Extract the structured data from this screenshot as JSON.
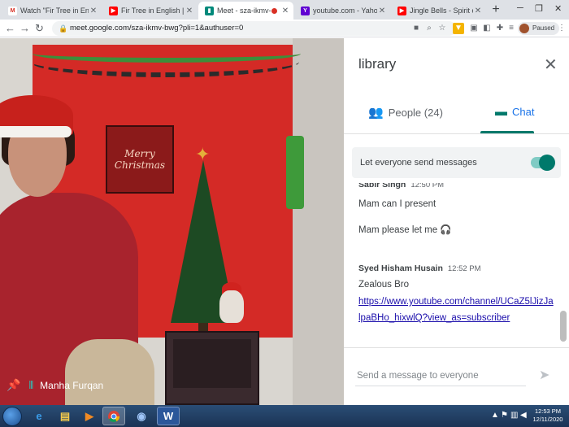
{
  "tabs": [
    {
      "label": "Watch \"Fir Tree in English | Stori",
      "favicon": "gmail-icon",
      "color": "#d93025"
    },
    {
      "label": "Fir Tree in English | Stories for T",
      "favicon": "youtube-icon",
      "color": "#ff0000"
    },
    {
      "label": "Meet - sza-ikmv-bwg",
      "favicon": "meet-icon",
      "color": "#00897b"
    },
    {
      "label": "youtube.com - Yahoo India Sea",
      "favicon": "yahoo-icon",
      "color": "#6001d2"
    },
    {
      "label": "Jingle Bells - Spirit of Love - Chr",
      "favicon": "youtube-icon",
      "color": "#ff0000"
    }
  ],
  "address_bar": {
    "url": "meet.google.com/sza-ikmv-bwg?pli=1&authuser=0"
  },
  "profile": {
    "status": "Paused"
  },
  "video": {
    "participant_name": "Manha Furqan",
    "poster_text": "Merry Christmas"
  },
  "panel": {
    "title": "library",
    "tabs": {
      "people": "People (24)",
      "chat": "Chat"
    },
    "toggle_label": "Let everyone send messages",
    "messages": [
      {
        "sender": "Sabir Singh",
        "time": "12:50 PM",
        "lines": [
          "Mam can I present",
          "Mam please let me 🎧"
        ]
      },
      {
        "sender": "Syed Hisham Husain",
        "time": "12:52 PM",
        "lines": [
          "Zealous Bro"
        ],
        "link": "https://www.youtube.com/channel/UCaZ5lJizJalpaBHo_hixwlQ?view_as=subscriber"
      }
    ],
    "compose_placeholder": "Send a message to everyone"
  },
  "taskbar": {
    "time": "12:53 PM",
    "date": "12/11/2020"
  }
}
